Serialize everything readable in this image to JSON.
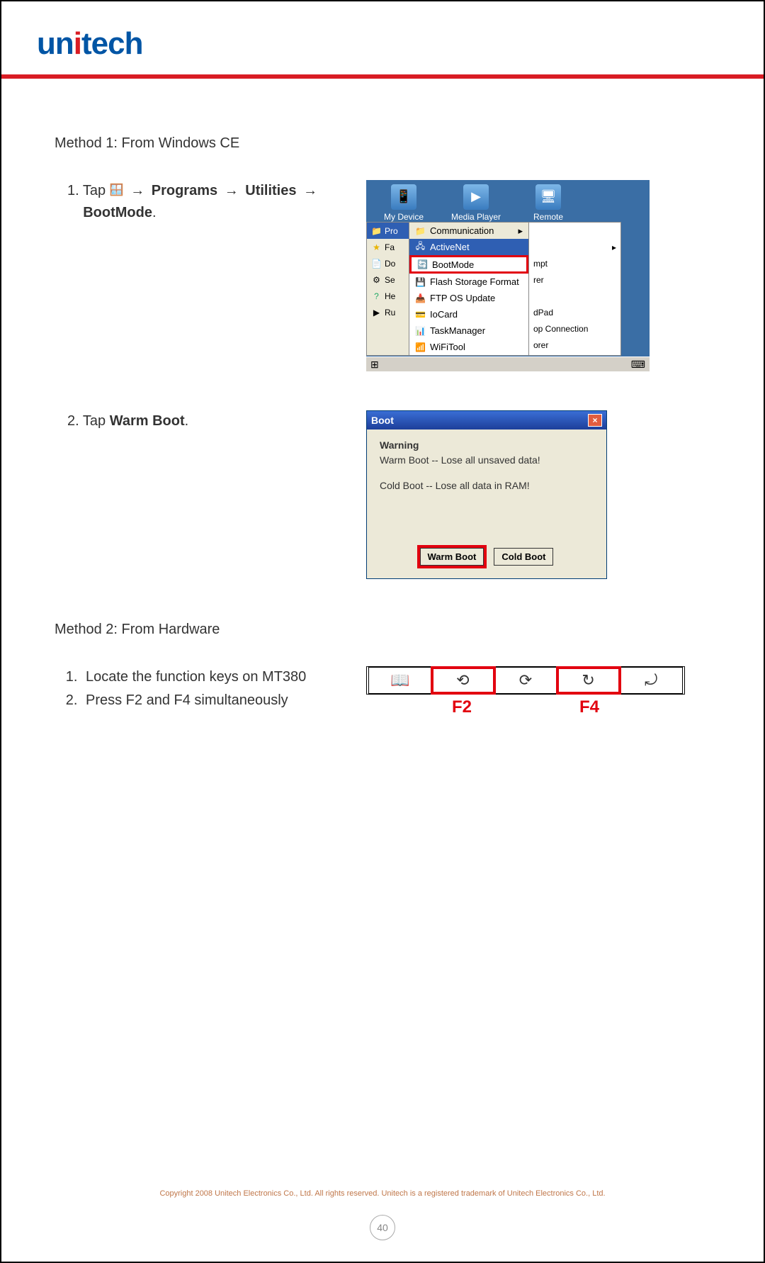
{
  "brand": {
    "part1": "un",
    "dot": "i",
    "part2": "tech"
  },
  "method1": {
    "heading": "Method 1: From Windows CE",
    "step1": {
      "num": "1.",
      "pre": "Tap ",
      "arrow": "→",
      "programs": "Programs",
      "utilities": "Utilities",
      "bootmode": "BootMode",
      "suffix": "."
    },
    "step2": {
      "num": "2.",
      "pre": "Tap ",
      "warm": "Warm Boot",
      "suffix": "."
    }
  },
  "wince": {
    "desktop": [
      {
        "label": "My Device",
        "glyph": "📱"
      },
      {
        "label": "Media Player",
        "glyph": "▶"
      },
      {
        "label": "Remote Desktop",
        "glyph": "🖥"
      }
    ],
    "startcol": [
      {
        "label": "Pro",
        "hl": true,
        "icon": "📁"
      },
      {
        "label": "Fa",
        "hl": false,
        "icon": "★"
      },
      {
        "label": "Do",
        "hl": false,
        "icon": "📄"
      },
      {
        "label": "Se",
        "hl": false,
        "icon": "⚙"
      },
      {
        "label": "He",
        "hl": false,
        "icon": "?"
      },
      {
        "label": "Ru",
        "hl": false,
        "icon": "▶"
      }
    ],
    "comm": "Communication",
    "prog": [
      {
        "label": "ActiveNet",
        "hl": true
      },
      {
        "label": "BootMode",
        "boot": true
      },
      {
        "label": "Flash Storage Format"
      },
      {
        "label": "FTP OS Update"
      },
      {
        "label": "IoCard"
      },
      {
        "label": "TaskManager"
      },
      {
        "label": "WiFiTool"
      }
    ],
    "rightcol": [
      "",
      "▸",
      "mpt",
      "rer",
      "",
      "dPad",
      "op Connection",
      "orer"
    ],
    "taskbar_start": "⊞",
    "taskbar_right": "⌨"
  },
  "boot": {
    "title": "Boot",
    "close": "×",
    "warning": "Warning",
    "line1": "Warm Boot -- Lose all unsaved data!",
    "line2": "Cold Boot -- Lose all data in RAM!",
    "warm": "Warm Boot",
    "cold": "Cold Boot"
  },
  "method2": {
    "heading": "Method 2: From Hardware",
    "steps": [
      "Locate the function keys on MT380",
      "Press F2 and F4 simultaneously"
    ],
    "keys": [
      {
        "glyph": "📖",
        "red": false,
        "label": ""
      },
      {
        "glyph": "⟲",
        "red": true,
        "label": "F2"
      },
      {
        "glyph": "⟳",
        "red": false,
        "label": ""
      },
      {
        "glyph": "↻",
        "red": true,
        "label": "F4"
      },
      {
        "glyph": "⤾",
        "red": false,
        "label": ""
      }
    ]
  },
  "footer": "Copyright 2008 Unitech Electronics Co., Ltd. All rights reserved. Unitech is a registered trademark of Unitech Electronics Co., Ltd.",
  "page": "40"
}
